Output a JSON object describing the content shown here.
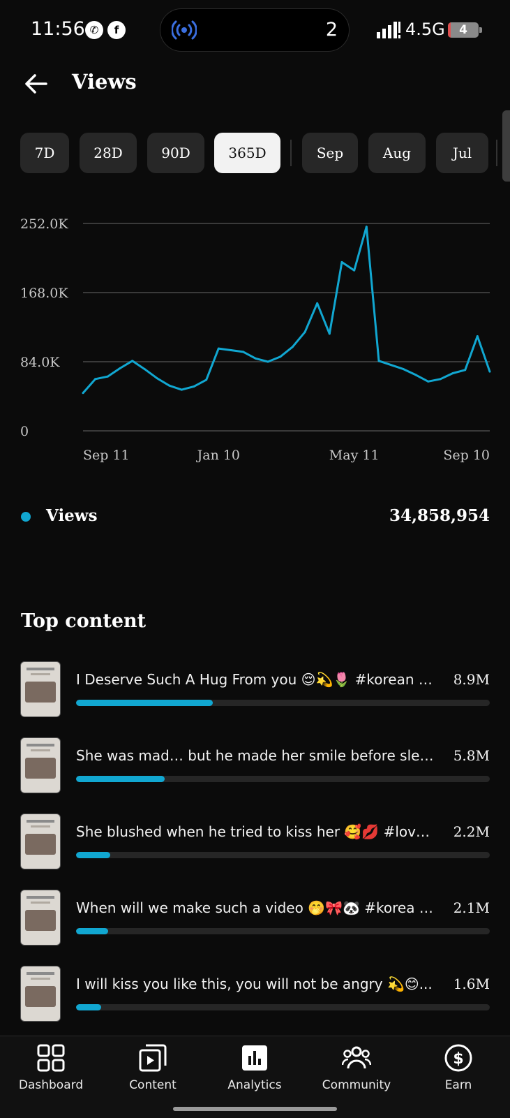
{
  "status_bar": {
    "time": "11:56",
    "notification_count": "2",
    "network": "4.5G",
    "battery": "4",
    "battery_level": 0.04
  },
  "header": {
    "title": "Views"
  },
  "ranges": [
    {
      "label": "7D"
    },
    {
      "label": "28D"
    },
    {
      "label": "90D"
    },
    {
      "label": "365D",
      "active": true
    },
    {
      "label": "Sep"
    },
    {
      "label": "Aug"
    },
    {
      "label": "Jul"
    }
  ],
  "chart_data": {
    "type": "line",
    "title": "",
    "xlabel": "",
    "ylabel": "",
    "x_ticks": [
      "Sep 11",
      "Jan 10",
      "May 11",
      "Sep 10"
    ],
    "y_ticks": [
      "0",
      "84.0K",
      "168.0K",
      "252.0K"
    ],
    "ylim": [
      0,
      252000
    ],
    "grid": true,
    "color": "#11a7d1",
    "series": [
      {
        "name": "Views",
        "x": [
          "Sep 11",
          "Sep 22",
          "Oct 3",
          "Oct 14",
          "Oct 25",
          "Nov 5",
          "Nov 16",
          "Nov 27",
          "Dec 8",
          "Dec 19",
          "Dec 30",
          "Jan 10",
          "Jan 21",
          "Feb 1",
          "Feb 12",
          "Feb 23",
          "Mar 6",
          "Mar 17",
          "Mar 28",
          "Apr 8",
          "Apr 19",
          "Apr 30",
          "May 11",
          "May 22",
          "Jun 2",
          "Jun 13",
          "Jun 24",
          "Jul 5",
          "Jul 16",
          "Jul 27",
          "Aug 7",
          "Aug 18",
          "Aug 29",
          "Sep 10"
        ],
        "values": [
          46000,
          63000,
          66000,
          76000,
          85000,
          75000,
          64000,
          55000,
          50000,
          54000,
          62000,
          100000,
          98000,
          96000,
          88000,
          84000,
          90000,
          102000,
          120000,
          155000,
          118000,
          205000,
          195000,
          248000,
          85000,
          80000,
          75000,
          68000,
          60000,
          63000,
          70000,
          74000,
          115000,
          72000
        ]
      }
    ]
  },
  "legend": {
    "label": "Views",
    "total": "34,858,954"
  },
  "top_content": {
    "title": "Top content",
    "items": [
      {
        "title": "I Deserve Such A Hug From you 😌💫🌷 #korean #...",
        "value": "8.9M",
        "share": 0.33
      },
      {
        "title": "She was mad… but he made her smile before sleep ...",
        "value": "5.8M",
        "share": 0.215
      },
      {
        "title": "She blushed when he tried to kiss her 🥰💋 #love #...",
        "value": "2.2M",
        "share": 0.083
      },
      {
        "title": "When will we make such a video 🤭🎀🐼 #korea #...",
        "value": "2.1M",
        "share": 0.078
      },
      {
        "title": "I will kiss you like this, you will not be angry 💫😊...",
        "value": "1.6M",
        "share": 0.06
      }
    ]
  },
  "nav": [
    {
      "label": "Dashboard",
      "icon": "dashboard-icon"
    },
    {
      "label": "Content",
      "icon": "content-icon"
    },
    {
      "label": "Analytics",
      "icon": "analytics-icon",
      "active": true
    },
    {
      "label": "Community",
      "icon": "community-icon"
    },
    {
      "label": "Earn",
      "icon": "earn-icon"
    }
  ]
}
